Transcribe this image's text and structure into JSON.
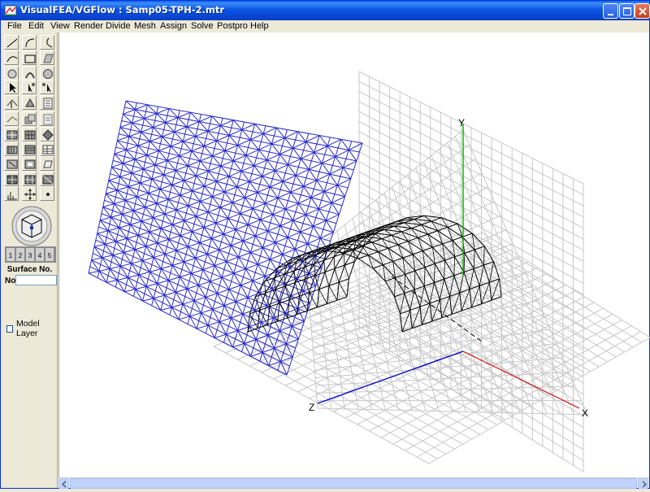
{
  "window": {
    "title": "VisualFEA/VGFlow :  Samp05-TPH-2.mtr"
  },
  "menu": [
    "File",
    "Edit",
    "View",
    "Render",
    "Divide",
    "Mesh",
    "Assign",
    "Solve",
    "Postpro",
    "Help"
  ],
  "panel": {
    "surface_label": "Surface No.",
    "no_label": "No",
    "no_value": "",
    "model_layer_label": "Model Layer",
    "model_layer_checked": false,
    "layer_numbers": [
      "1",
      "2",
      "3",
      "4",
      "5"
    ]
  },
  "axes": {
    "x": "X",
    "y": "Y",
    "z": "Z"
  },
  "colors": {
    "surface_mesh": "#2a2ac8",
    "grid": "#c8c8c8",
    "arch_mesh": "#000000",
    "y_axis": "#00b000",
    "z_axis": "#0000c8",
    "x_axis": "#c80000"
  },
  "icons": [
    "line-icon",
    "arc-icon",
    "arc-open-icon",
    "curve-icon",
    "rectangle-icon",
    "quad-surface-icon",
    "circle-icon",
    "arch-icon",
    "sphere-icon",
    "select-arrow-icon",
    "select-node-icon",
    "select-multi-icon",
    "pick-edge-icon",
    "pick-face-icon",
    "doc-list-icon",
    "extrude-icon",
    "copy-icon",
    "list-icon",
    "mesh-solid-icon",
    "mesh-block-icon",
    "mesh-grid-icon",
    "stack-icon",
    "layer-icon",
    "table-icon",
    "box-edit-icon",
    "box-edit2-icon",
    "shape-icon",
    "mesh-view-icon",
    "mesh-view2-icon",
    "mesh-view3-icon",
    "graph-icon",
    "move-icon",
    "dot-icon"
  ]
}
